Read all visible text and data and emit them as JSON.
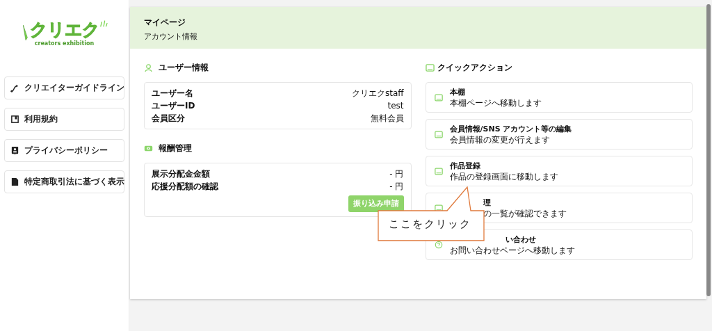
{
  "logo": {
    "text": "クリエク",
    "subtitle": "creators exhibition"
  },
  "sidebar": {
    "items": [
      {
        "label": "クリエイターガイドライン"
      },
      {
        "label": "利用規約"
      },
      {
        "label": "プライバシーポリシー"
      },
      {
        "label": "特定商取引法に基づく表示"
      }
    ]
  },
  "header": {
    "title": "マイページ",
    "subtitle": "アカウント情報"
  },
  "user_info": {
    "title": "ユーザー情報",
    "rows": [
      {
        "label": "ユーザー名",
        "value": "クリエクstaff"
      },
      {
        "label": "ユーザーID",
        "value": "test"
      },
      {
        "label": "会員区分",
        "value": "無料会員"
      }
    ]
  },
  "rewards": {
    "title": "報酬管理",
    "rows": [
      {
        "label": "展示分配金金額",
        "value": "- 円"
      },
      {
        "label": "応援分配額の確認",
        "value": "- 円"
      }
    ],
    "button": "振り込み申請"
  },
  "quick_actions": {
    "title": "クイックアクション",
    "items": [
      {
        "kind": "full",
        "title": [
          "本棚"
        ],
        "description": [
          "本棚ページへ移動します"
        ]
      },
      {
        "kind": "full",
        "title": [
          "会員情報/SNS アカウント等の編集"
        ],
        "description": [
          "会員情報の変更が行えます"
        ]
      },
      {
        "kind": "full",
        "title": [
          "作品登録"
        ],
        "description": [
          "作品の登録画面に移動します"
        ]
      },
      {
        "kind": "covered",
        "title": [
          "理"
        ],
        "description": [
          "の一覧が確認できます"
        ]
      },
      {
        "kind": "covered",
        "title": [
          "い合わせ"
        ],
        "description": [
          "お問い合わせページへ移動します"
        ]
      }
    ]
  },
  "callout": {
    "text": "ここをクリック"
  }
}
